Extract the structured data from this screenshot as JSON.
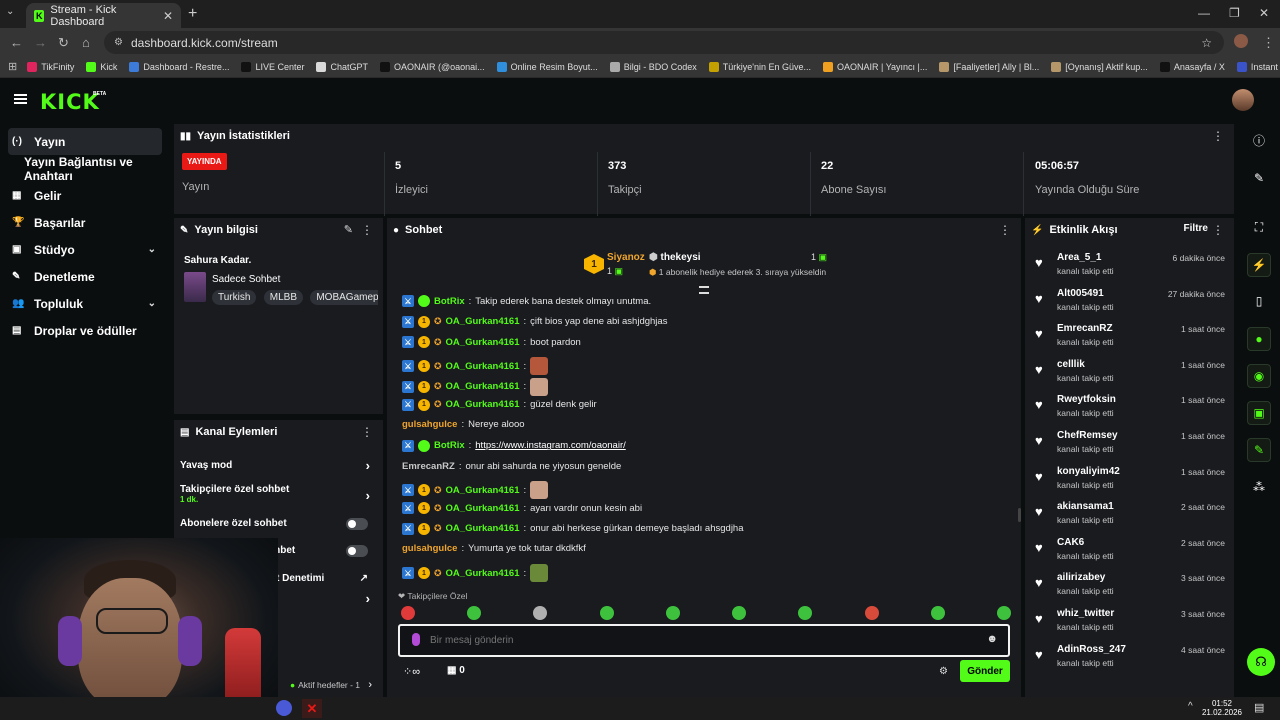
{
  "browser": {
    "tab_title": "Stream - Kick Dashboard",
    "favicon_letter": "K",
    "url": "dashboard.kick.com/stream",
    "bookmarks": [
      {
        "label": "TikFinity",
        "color": "#e0245e"
      },
      {
        "label": "Kick",
        "color": "#53fc18"
      },
      {
        "label": "Dashboard - Restre...",
        "color": "#3d7bd9"
      },
      {
        "label": "LIVE Center",
        "color": "#111111"
      },
      {
        "label": "ChatGPT",
        "color": "#d9d9d9"
      },
      {
        "label": "OAONAIR (@oaonai...",
        "color": "#111111"
      },
      {
        "label": "Online Resim Boyut...",
        "color": "#2f8fdd"
      },
      {
        "label": "Bilgi - BDO Codex",
        "color": "#aaaaaa"
      },
      {
        "label": "Türkiye'nin En Güve...",
        "color": "#c4a000"
      },
      {
        "label": "OAONAIR | Yayıncı |...",
        "color": "#f0a020"
      },
      {
        "label": "[Faaliyetler] Ally | Bl...",
        "color": "#b5976a"
      },
      {
        "label": "[Oynanış] Aktif kup...",
        "color": "#b5976a"
      },
      {
        "label": "Anasayfa / X",
        "color": "#111111"
      },
      {
        "label": "Instant Background...",
        "color": "#3a53c9"
      }
    ]
  },
  "kick": {
    "logo": "KICK",
    "beta": "BETA"
  },
  "sidebar": {
    "items": [
      {
        "label": "Yayın",
        "icon": "broadcast-icon",
        "glyph": "(·)"
      },
      {
        "label": "Yayın Bağlantısı ve Anahtarı",
        "icon": "",
        "glyph": ""
      },
      {
        "label": "Gelir",
        "icon": "money-icon",
        "glyph": "▦"
      },
      {
        "label": "Başarılar",
        "icon": "trophy-icon",
        "glyph": "🏆"
      },
      {
        "label": "Stüdyo",
        "icon": "studio-icon",
        "glyph": "▣"
      },
      {
        "label": "Denetleme",
        "icon": "wrench-icon",
        "glyph": "✎"
      },
      {
        "label": "Topluluk",
        "icon": "community-icon",
        "glyph": "👥"
      },
      {
        "label": "Droplar ve ödüller",
        "icon": "gift-icon",
        "glyph": "▤"
      }
    ]
  },
  "stats": {
    "title": "Yayın İstatistikleri",
    "live_badge": "YAYINDA",
    "live_label": "Yayın",
    "viewers_value": "5",
    "viewers_label": "İzleyici",
    "followers_value": "373",
    "followers_label": "Takipçi",
    "subs_value": "22",
    "subs_label": "Abone Sayısı",
    "uptime_value": "05:06:57",
    "uptime_label": "Yayında Olduğu Süre"
  },
  "stream_info": {
    "title": "Yayın bilgisi",
    "stream_title": "Sahura Kadar.",
    "category": "Sadece Sohbet",
    "tags": [
      "Turkish",
      "MLBB",
      "MOBAGamepla"
    ]
  },
  "channel_actions": {
    "title": "Kanal Eylemleri",
    "slow_mode": "Yavaş mod",
    "followers_chat": "Takipçilere özel sohbet",
    "followers_chat_sub": "1 dk.",
    "subs_chat": "Abonelere özel sohbet",
    "emote_chat": "ohbet",
    "mod_label": "t Denetimi",
    "goals": "Aktif hedefler - 1"
  },
  "chat": {
    "title": "Sohbet",
    "pinned_name": "Siyanoz",
    "pinned_count": "1",
    "pinned_badge_num": "1",
    "gifter_name": "thekeysi",
    "gifter_count": "1",
    "gifter_msg": "1 abonelik hediye ederek 3. sıraya yükseldin",
    "lines": [
      {
        "badges": "botrix",
        "user": "BotRix",
        "color": "#53fc18",
        "text": "Takip ederek bana destek olmayı unutma.",
        "emote": ""
      },
      {
        "badges": "full",
        "user": "OA_Gurkan4161",
        "color": "#53fc18",
        "text": "çift bios yap dene abi ashjdghjas",
        "emote": ""
      },
      {
        "badges": "full",
        "user": "OA_Gurkan4161",
        "color": "#53fc18",
        "text": "boot pardon",
        "emote": ""
      },
      {
        "badges": "full",
        "user": "OA_Gurkan4161",
        "color": "#53fc18",
        "text": "",
        "emote": "#b5573a"
      },
      {
        "badges": "full",
        "user": "OA_Gurkan4161",
        "color": "#53fc18",
        "text": "",
        "emote": "#c9a08a"
      },
      {
        "badges": "full",
        "user": "OA_Gurkan4161",
        "color": "#53fc18",
        "text": "güzel denk gelir",
        "emote": ""
      },
      {
        "badges": "none",
        "user": "gulsahgulce",
        "color": "#f0a52c",
        "text": "Nereye alooo",
        "emote": ""
      },
      {
        "badges": "botrix",
        "user": "BotRix",
        "color": "#53fc18",
        "text": "https://www.instagram.com/oaonair/",
        "emote": "",
        "link": true
      },
      {
        "badges": "none",
        "user": "EmrecanRZ",
        "color": "#c8c8c8",
        "text": "onur abi sahurda ne yiyosun genelde",
        "emote": ""
      },
      {
        "badges": "full",
        "user": "OA_Gurkan4161",
        "color": "#53fc18",
        "text": "",
        "emote": "#c9a08a"
      },
      {
        "badges": "full",
        "user": "OA_Gurkan4161",
        "color": "#53fc18",
        "text": "ayarı vardır onun kesin abi",
        "emote": ""
      },
      {
        "badges": "full",
        "user": "OA_Gurkan4161",
        "color": "#53fc18",
        "text": "onur abi herkese gürkan demeye başladı ahsgdjha",
        "emote": ""
      },
      {
        "badges": "none",
        "user": "gulsahgulce",
        "color": "#f0a52c",
        "text": "Yumurta ye tok tutar dkdkfkf",
        "emote": ""
      },
      {
        "badges": "full",
        "user": "OA_Gurkan4161",
        "color": "#53fc18",
        "text": "",
        "emote": "#6a8a3a"
      }
    ],
    "followers_only": "Takipçilere Özel",
    "placeholder": "Bir mesaj gönderin",
    "points": "0",
    "send": "Gönder"
  },
  "events": {
    "title": "Etkinlik Akışı",
    "filter": "Filtre",
    "items": [
      {
        "name": "Area_5_1",
        "sub": "kanalı takip etti",
        "time": "6 dakika önce"
      },
      {
        "name": "Alt005491",
        "sub": "kanalı takip etti",
        "time": "27 dakika önce"
      },
      {
        "name": "EmrecanRZ",
        "sub": "kanalı takip etti",
        "time": "1 saat önce"
      },
      {
        "name": "celllik",
        "sub": "kanalı takip etti",
        "time": "1 saat önce"
      },
      {
        "name": "Rweytfoksin",
        "sub": "kanalı takip etti",
        "time": "1 saat önce"
      },
      {
        "name": "ChefRemsey",
        "sub": "kanalı takip etti",
        "time": "1 saat önce"
      },
      {
        "name": "konyaliyim42",
        "sub": "kanalı takip etti",
        "time": "1 saat önce"
      },
      {
        "name": "akiansama1",
        "sub": "kanalı takip etti",
        "time": "2 saat önce"
      },
      {
        "name": "CAK6",
        "sub": "kanalı takip etti",
        "time": "2 saat önce"
      },
      {
        "name": "ailirizabey",
        "sub": "kanalı takip etti",
        "time": "3 saat önce"
      },
      {
        "name": "whiz_twitter",
        "sub": "kanalı takip etti",
        "time": "3 saat önce"
      },
      {
        "name": "AdinRoss_247",
        "sub": "kanalı takip etti",
        "time": "4 saat önce"
      }
    ]
  },
  "taskbar": {
    "time": "01:52",
    "date": "21.02.2026"
  },
  "colors": {
    "kick_green": "#53fc18",
    "live_red": "#e91916",
    "panel_bg": "#191b1f"
  }
}
